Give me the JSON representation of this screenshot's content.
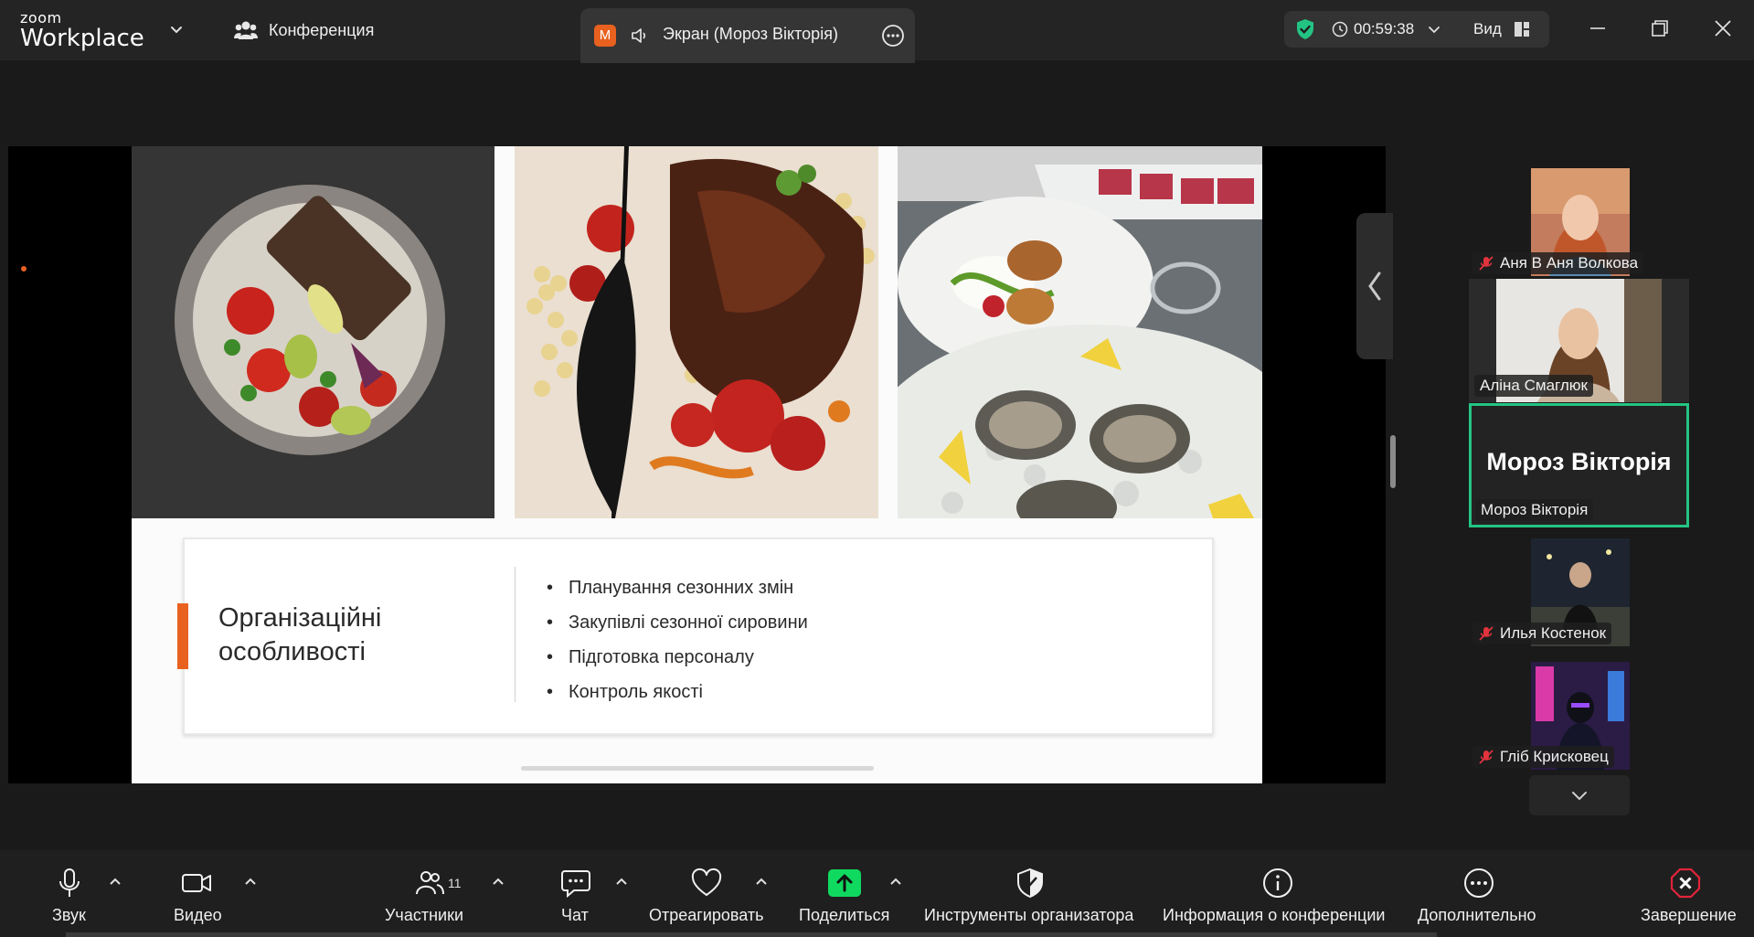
{
  "app": {
    "logo_line1": "zoom",
    "logo_line2": "Workplace"
  },
  "topbar": {
    "meeting_label": "Конференция",
    "screen_tab": {
      "badge": "M",
      "title": "Экран (Мороз Вікторія)"
    },
    "timer": "00:59:38",
    "view_label": "Вид"
  },
  "slide": {
    "heading": "Організаційні особливості",
    "bullets": [
      "Планування сезонних змін",
      "Закупівлі сезонної сировини",
      "Підготовка персоналу",
      "Контроль якості"
    ]
  },
  "participants": [
    {
      "name": "Аня В Аня Волкова",
      "muted": true
    },
    {
      "name": "Аліна Смаглюк",
      "muted": false
    },
    {
      "name": "Мороз Вікторія",
      "muted": false,
      "active_speaker": true,
      "display_name": "Мороз Вікторія"
    },
    {
      "name": "Илья Костенок",
      "muted": true
    },
    {
      "name": "Гліб Крисковец",
      "muted": true
    }
  ],
  "toolbar": {
    "audio": "Звук",
    "video": "Видео",
    "participants": "Участники",
    "participants_count": "11",
    "chat": "Чат",
    "react": "Отреагировать",
    "share": "Поделиться",
    "host_tools": "Инструменты организатора",
    "meeting_info": "Информация о конференции",
    "more": "Дополнительно",
    "end": "Завершение"
  },
  "colors": {
    "accent_green": "#23c483",
    "share_green": "#10d95f",
    "end_red": "#e0243a",
    "slide_accent": "#e8611f"
  }
}
